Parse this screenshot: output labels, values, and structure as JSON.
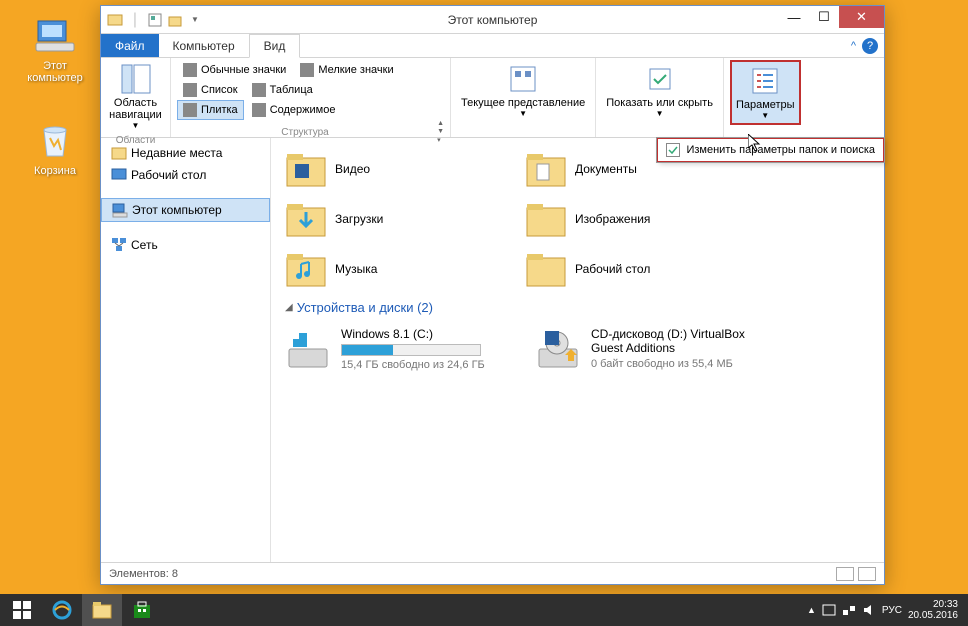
{
  "desktop": {
    "icons": [
      {
        "label": "Этот компьютер"
      },
      {
        "label": "Корзина"
      }
    ]
  },
  "window": {
    "title": "Этот компьютер"
  },
  "ribbon": {
    "tabs": {
      "file": "Файл",
      "computer": "Компьютер",
      "view": "Вид"
    },
    "groups": {
      "areas": {
        "label": "Области",
        "nav": "Область навигации"
      },
      "structure": {
        "label": "Структура",
        "items": {
          "normal": "Обычные значки",
          "small": "Мелкие значки",
          "list": "Список",
          "table": "Таблица",
          "tiles": "Плитка",
          "content": "Содержимое"
        }
      },
      "current": "Текущее представление",
      "show": "Показать или скрыть",
      "params": "Параметры",
      "dropdown": "Изменить параметры папок и поиска"
    }
  },
  "sidebar": {
    "items": [
      {
        "label": "Недавние места"
      },
      {
        "label": "Рабочий стол"
      },
      {
        "label": "Этот компьютер"
      },
      {
        "label": "Сеть"
      }
    ]
  },
  "content": {
    "folders": [
      {
        "label": "Видео"
      },
      {
        "label": "Документы"
      },
      {
        "label": "Загрузки"
      },
      {
        "label": "Изображения"
      },
      {
        "label": "Музыка"
      },
      {
        "label": "Рабочий стол"
      }
    ],
    "devices_header": "Устройства и диски (2)",
    "drives": [
      {
        "name": "Windows 8.1 (C:)",
        "sub": "15,4 ГБ свободно из 24,6 ГБ",
        "fill": 37
      },
      {
        "name": "CD-дисковод (D:) VirtualBox Guest Additions",
        "sub": "0 байт свободно из 55,4 МБ",
        "fill": 0
      }
    ]
  },
  "statusbar": {
    "text": "Элементов: 8"
  },
  "tray": {
    "lang": "РУС",
    "time": "20:33",
    "date": "20.05.2016"
  }
}
